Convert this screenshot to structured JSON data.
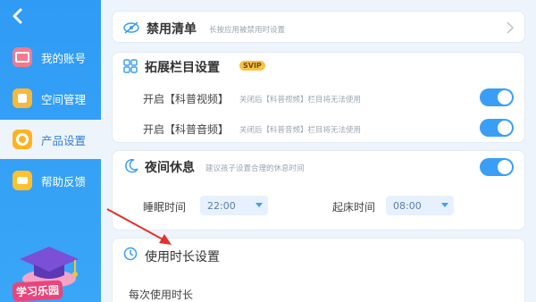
{
  "sidebar": {
    "back_label": "<",
    "items": [
      {
        "label": "我的账号",
        "icon": "account-icon"
      },
      {
        "label": "空间管理",
        "icon": "space-icon"
      },
      {
        "label": "产品设置",
        "icon": "settings-gear-icon",
        "active": true
      },
      {
        "label": "帮助反馈",
        "icon": "message-icon"
      }
    ],
    "logo_text": "学习乐园"
  },
  "banned": {
    "title": "禁用清单",
    "desc": "长按应用被禁用时设置"
  },
  "column": {
    "title": "拓展栏目设置",
    "badge": "SVIP",
    "rows": [
      {
        "label": "开启【科普视频】",
        "note": "关闭后【科普视频】栏目将无法使用",
        "on": true
      },
      {
        "label": "开启【科普音频】",
        "note": "关闭后【科普音频】栏目将无法使用",
        "on": true
      }
    ]
  },
  "night": {
    "title": "夜间休息",
    "desc": "建议孩子设置合理的休息时间",
    "on": true,
    "sleep_label": "睡眠时间",
    "sleep_value": "22:00",
    "wake_label": "起床时间",
    "wake_value": "08:00"
  },
  "usage": {
    "title": "使用时长设置",
    "per_use_label": "每次使用时长"
  },
  "colors": {
    "accent": "#3a9ef6",
    "sidebar": "#2f9bf5",
    "arrow": "#e0322d"
  }
}
